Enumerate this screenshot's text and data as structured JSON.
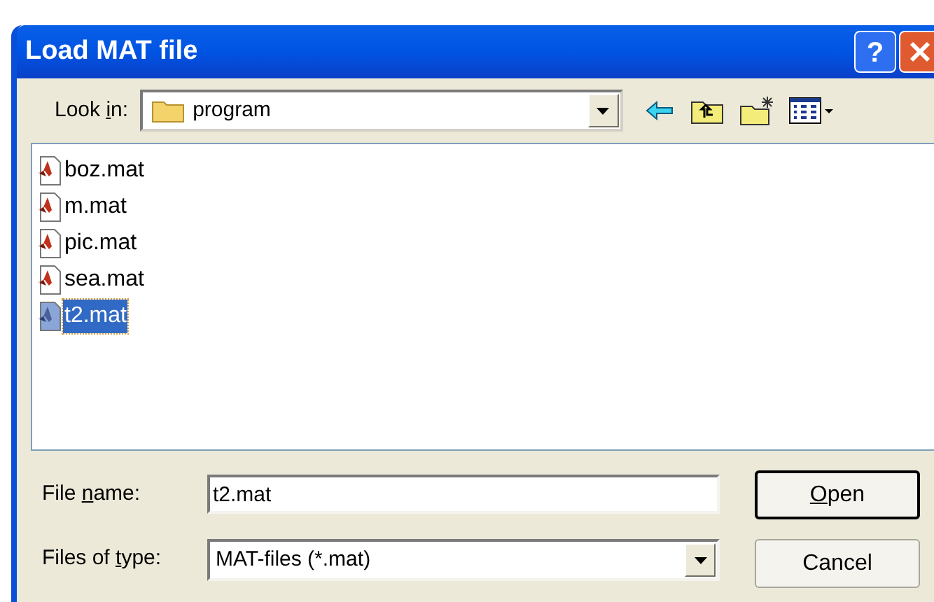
{
  "window": {
    "title": "Load MAT file"
  },
  "look_in": {
    "label": {
      "before": "Look ",
      "key": "i",
      "after": "n:"
    },
    "value": "program"
  },
  "files": [
    {
      "name": "boz.mat",
      "selected": false
    },
    {
      "name": "m.mat",
      "selected": false
    },
    {
      "name": "pic.mat",
      "selected": false
    },
    {
      "name": "sea.mat",
      "selected": false
    },
    {
      "name": "t2.mat",
      "selected": true
    }
  ],
  "file_name": {
    "label": {
      "before": "File ",
      "key": "n",
      "after": "ame:"
    },
    "value": "t2.mat"
  },
  "file_type": {
    "label": {
      "before": "Files of ",
      "key": "t",
      "after": "ype:"
    },
    "value": "MAT-files (*.mat)"
  },
  "buttons": [
    {
      "key": "O",
      "after": "pen",
      "default": true
    },
    {
      "before": "Cancel",
      "default": false
    }
  ],
  "title_buttons": [
    "?"
  ]
}
